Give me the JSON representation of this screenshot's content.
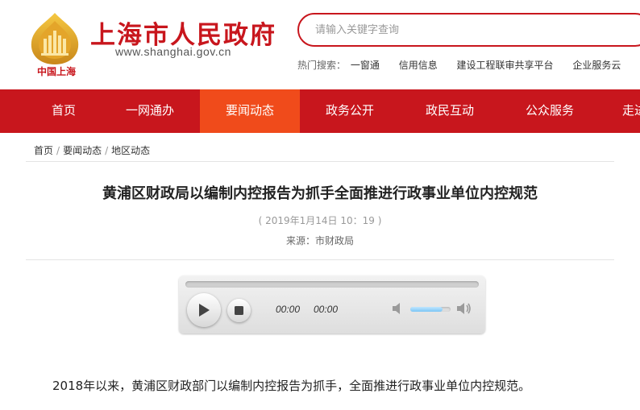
{
  "header": {
    "logo_caption": "中国上海",
    "site_title": "上海市人民政府",
    "site_url": "www.shanghai.gov.cn",
    "search_placeholder": "请输入关键字查询",
    "hot_label": "热门搜索：",
    "hot_links": [
      "一窗通",
      "信用信息",
      "建设工程联审共享平台",
      "企业服务云"
    ]
  },
  "nav": {
    "items": [
      "首页",
      "一网通办",
      "要闻动态",
      "政务公开",
      "政民互动",
      "公众服务",
      "走进上海"
    ],
    "active": "要闻动态"
  },
  "breadcrumb": [
    "首页",
    "要闻动态",
    "地区动态"
  ],
  "article": {
    "title": "黄浦区财政局以编制内控报告为抓手全面推进行政事业单位内控规范",
    "time": "( 2019年1月14日 10：19 )",
    "source_label": "来源：",
    "source": "市财政局",
    "body": "2018年以来，黄浦区财政部门以编制内控报告为抓手，全面推进行政事业单位内控规范。"
  },
  "player": {
    "current_time": "00:00",
    "duration": "00:00",
    "progress_fraction": 0,
    "volume_fraction": 0.8
  },
  "colors": {
    "brand_red": "#c8161d",
    "nav_active": "#f04b1b"
  }
}
